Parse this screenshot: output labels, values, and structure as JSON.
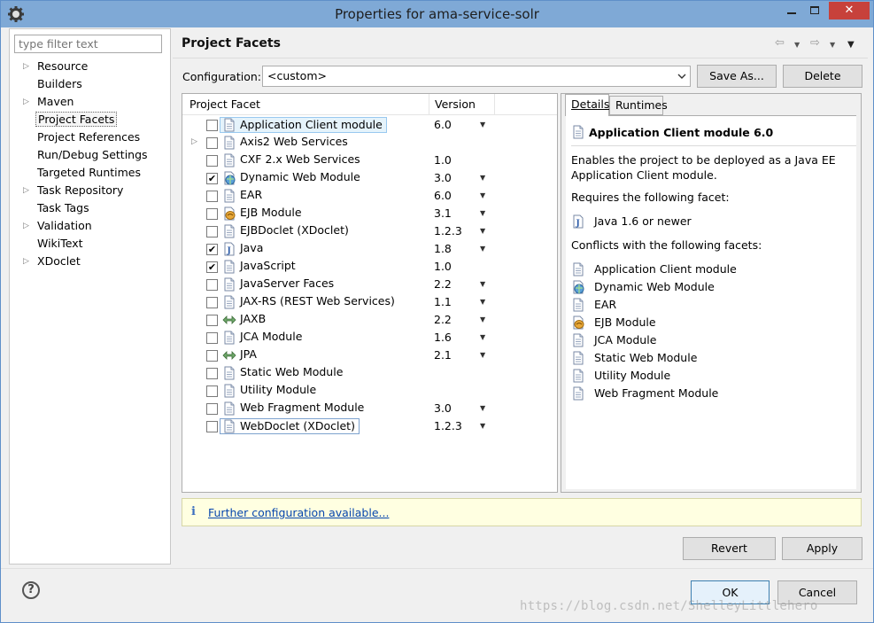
{
  "window": {
    "title": "Properties for ama-service-solr"
  },
  "nav": {
    "filter_placeholder": "type filter text",
    "items": [
      {
        "label": "Resource",
        "expandable": true,
        "selected": false
      },
      {
        "label": "Builders",
        "expandable": false,
        "selected": false
      },
      {
        "label": "Maven",
        "expandable": true,
        "selected": false
      },
      {
        "label": "Project Facets",
        "expandable": false,
        "selected": true
      },
      {
        "label": "Project References",
        "expandable": false,
        "selected": false
      },
      {
        "label": "Run/Debug Settings",
        "expandable": false,
        "selected": false
      },
      {
        "label": "Targeted Runtimes",
        "expandable": false,
        "selected": false
      },
      {
        "label": "Task Repository",
        "expandable": true,
        "selected": false
      },
      {
        "label": "Task Tags",
        "expandable": false,
        "selected": false
      },
      {
        "label": "Validation",
        "expandable": true,
        "selected": false
      },
      {
        "label": "WikiText",
        "expandable": false,
        "selected": false
      },
      {
        "label": "XDoclet",
        "expandable": true,
        "selected": false
      }
    ]
  },
  "page": {
    "title": "Project Facets"
  },
  "config": {
    "label": "Configuration:",
    "value": "<custom>",
    "save_as": "Save As...",
    "delete": "Delete"
  },
  "facets": {
    "header_facet": "Project Facet",
    "header_version": "Version",
    "rows": [
      {
        "name": "Application Client module",
        "version": "6.0",
        "checked": false,
        "dropdown": true,
        "icon": "page-icon",
        "state": "selected"
      },
      {
        "name": "Axis2 Web Services",
        "version": "",
        "checked": false,
        "dropdown": false,
        "icon": "page-icon",
        "expander": true
      },
      {
        "name": "CXF 2.x Web Services",
        "version": "1.0",
        "checked": false,
        "dropdown": false,
        "icon": "page-icon"
      },
      {
        "name": "Dynamic Web Module",
        "version": "3.0",
        "checked": true,
        "dropdown": true,
        "icon": "web-globe-icon"
      },
      {
        "name": "EAR",
        "version": "6.0",
        "checked": false,
        "dropdown": true,
        "icon": "page-icon"
      },
      {
        "name": "EJB Module",
        "version": "3.1",
        "checked": false,
        "dropdown": true,
        "icon": "ejb-bean-icon"
      },
      {
        "name": "EJBDoclet (XDoclet)",
        "version": "1.2.3",
        "checked": false,
        "dropdown": true,
        "icon": "page-icon"
      },
      {
        "name": "Java",
        "version": "1.8",
        "checked": true,
        "dropdown": true,
        "icon": "java-icon"
      },
      {
        "name": "JavaScript",
        "version": "1.0",
        "checked": true,
        "dropdown": false,
        "icon": "page-icon"
      },
      {
        "name": "JavaServer Faces",
        "version": "2.2",
        "checked": false,
        "dropdown": true,
        "icon": "page-icon"
      },
      {
        "name": "JAX-RS (REST Web Services)",
        "version": "1.1",
        "checked": false,
        "dropdown": true,
        "icon": "page-icon"
      },
      {
        "name": "JAXB",
        "version": "2.2",
        "checked": false,
        "dropdown": true,
        "icon": "jaxb-arrows-icon"
      },
      {
        "name": "JCA Module",
        "version": "1.6",
        "checked": false,
        "dropdown": true,
        "icon": "page-icon"
      },
      {
        "name": "JPA",
        "version": "2.1",
        "checked": false,
        "dropdown": true,
        "icon": "jaxb-arrows-icon"
      },
      {
        "name": "Static Web Module",
        "version": "",
        "checked": false,
        "dropdown": false,
        "icon": "page-icon"
      },
      {
        "name": "Utility Module",
        "version": "",
        "checked": false,
        "dropdown": false,
        "icon": "page-icon"
      },
      {
        "name": "Web Fragment Module",
        "version": "3.0",
        "checked": false,
        "dropdown": true,
        "icon": "page-icon"
      },
      {
        "name": "WebDoclet (XDoclet)",
        "version": "1.2.3",
        "checked": false,
        "dropdown": true,
        "icon": "page-icon",
        "state": "outlined"
      }
    ]
  },
  "details": {
    "tab_details": "Details",
    "tab_runtimes": "Runtimes",
    "title": "Application Client module 6.0",
    "description": "Enables the project to be deployed as a Java EE Application Client module.",
    "requires_label": "Requires the following facet:",
    "requires": [
      {
        "name": "Java 1.6 or newer",
        "icon": "java-icon"
      }
    ],
    "conflicts_label": "Conflicts with the following facets:",
    "conflicts": [
      {
        "name": "Application Client module",
        "icon": "page-icon"
      },
      {
        "name": "Dynamic Web Module",
        "icon": "web-globe-icon"
      },
      {
        "name": "EAR",
        "icon": "page-icon"
      },
      {
        "name": "EJB Module",
        "icon": "ejb-bean-icon"
      },
      {
        "name": "JCA Module",
        "icon": "page-icon"
      },
      {
        "name": "Static Web Module",
        "icon": "page-icon"
      },
      {
        "name": "Utility Module",
        "icon": "page-icon"
      },
      {
        "name": "Web Fragment Module",
        "icon": "page-icon"
      }
    ]
  },
  "info": {
    "link": "Further configuration available..."
  },
  "buttons": {
    "revert": "Revert",
    "apply": "Apply",
    "ok": "OK",
    "cancel": "Cancel",
    "help": "?"
  },
  "watermark": "https://blog.csdn.net/ShelleyLittlehero",
  "colors": {
    "titlebar": "#7fa9d6",
    "close_button": "#c7413b",
    "link": "#0645ad",
    "selection": "#e5f3fb"
  }
}
